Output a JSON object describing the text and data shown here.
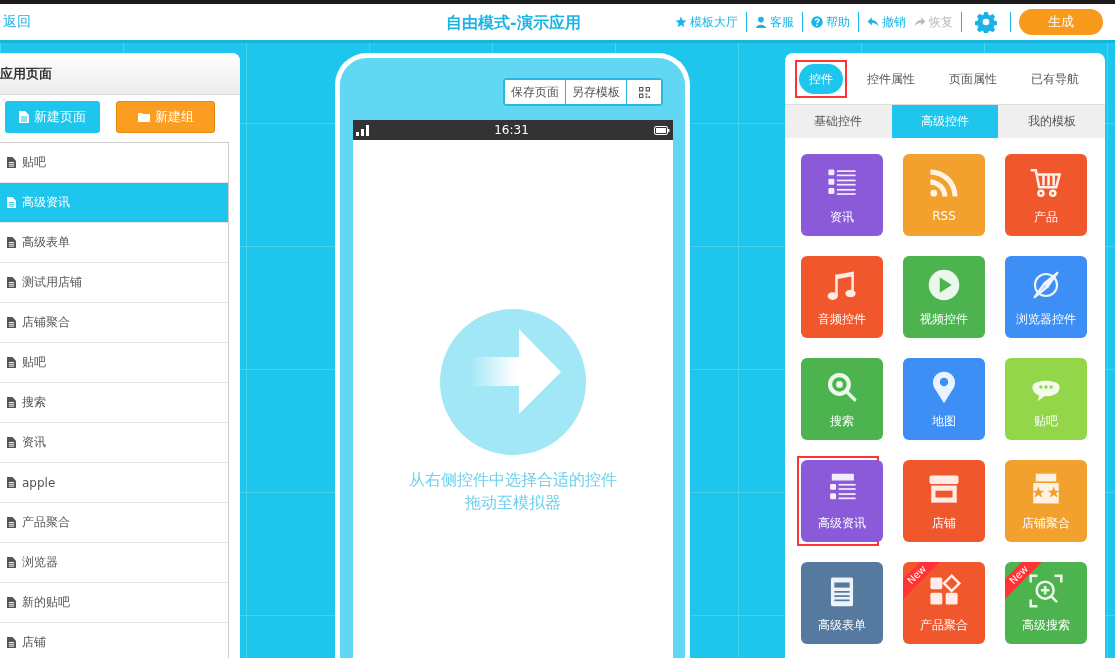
{
  "header": {
    "back": "返回",
    "title": "自由模式-演示应用",
    "actions": [
      {
        "label": "模板大厅",
        "disabled": false
      },
      {
        "label": "客服",
        "disabled": false
      },
      {
        "label": "帮助",
        "disabled": false
      },
      {
        "label": "撤销",
        "disabled": false
      },
      {
        "label": "恢复",
        "disabled": true
      }
    ],
    "generate": "生成"
  },
  "pages_panel": {
    "title": "应用页面",
    "new_page": "新建页面",
    "new_group": "新建组",
    "items": [
      {
        "label": "贴吧",
        "selected": false
      },
      {
        "label": "高级资讯",
        "selected": true
      },
      {
        "label": "高级表单",
        "selected": false
      },
      {
        "label": "测试用店铺",
        "selected": false
      },
      {
        "label": "店铺聚合",
        "selected": false
      },
      {
        "label": "贴吧",
        "selected": false
      },
      {
        "label": "搜索",
        "selected": false
      },
      {
        "label": "资讯",
        "selected": false
      },
      {
        "label": "apple",
        "selected": false
      },
      {
        "label": "产品聚合",
        "selected": false
      },
      {
        "label": "浏览器",
        "selected": false
      },
      {
        "label": "新的贴吧",
        "selected": false
      },
      {
        "label": "店铺",
        "selected": false
      }
    ]
  },
  "simulator": {
    "toolbar": [
      "保存页面",
      "另存模板"
    ],
    "time": "16:31",
    "hint": [
      "从右侧控件中选择合适的控件",
      "拖动至模拟器"
    ]
  },
  "widgets_panel": {
    "tabs": [
      {
        "label": "控件",
        "selected": true,
        "highlighted": true
      },
      {
        "label": "控件属性",
        "selected": false,
        "highlighted": false
      },
      {
        "label": "页面属性",
        "selected": false,
        "highlighted": false
      },
      {
        "label": "已有导航",
        "selected": false,
        "highlighted": false
      }
    ],
    "subtabs": [
      {
        "label": "基础控件",
        "selected": false
      },
      {
        "label": "高级控件",
        "selected": true
      },
      {
        "label": "我的模板",
        "selected": false
      }
    ],
    "tiles": [
      {
        "label": "资讯",
        "color": "#8a5ad8",
        "highlighted": false
      },
      {
        "label": "RSS",
        "color": "#f2a12e",
        "highlighted": false
      },
      {
        "label": "产品",
        "color": "#f1572c",
        "highlighted": false
      },
      {
        "label": "音频控件",
        "color": "#f1572c",
        "highlighted": false
      },
      {
        "label": "视频控件",
        "color": "#4cb34f",
        "highlighted": false
      },
      {
        "label": "浏览器控件",
        "color": "#3d8ef5",
        "highlighted": false
      },
      {
        "label": "搜索",
        "color": "#4cb34f",
        "highlighted": false
      },
      {
        "label": "地图",
        "color": "#3d8ef5",
        "highlighted": false
      },
      {
        "label": "贴吧",
        "color": "#94d64a",
        "highlighted": false
      },
      {
        "label": "高级资讯",
        "color": "#8a5ad8",
        "highlighted": true
      },
      {
        "label": "店铺",
        "color": "#f1572c",
        "highlighted": false
      },
      {
        "label": "店铺聚合",
        "color": "#f2a12e",
        "highlighted": false
      },
      {
        "label": "高级表单",
        "color": "#55799f",
        "highlighted": false
      },
      {
        "label": "产品聚合",
        "color": "#f1572c",
        "badge": "New",
        "highlighted": false
      },
      {
        "label": "高级搜索",
        "color": "#4cb34f",
        "badge": "New",
        "highlighted": false
      }
    ]
  }
}
